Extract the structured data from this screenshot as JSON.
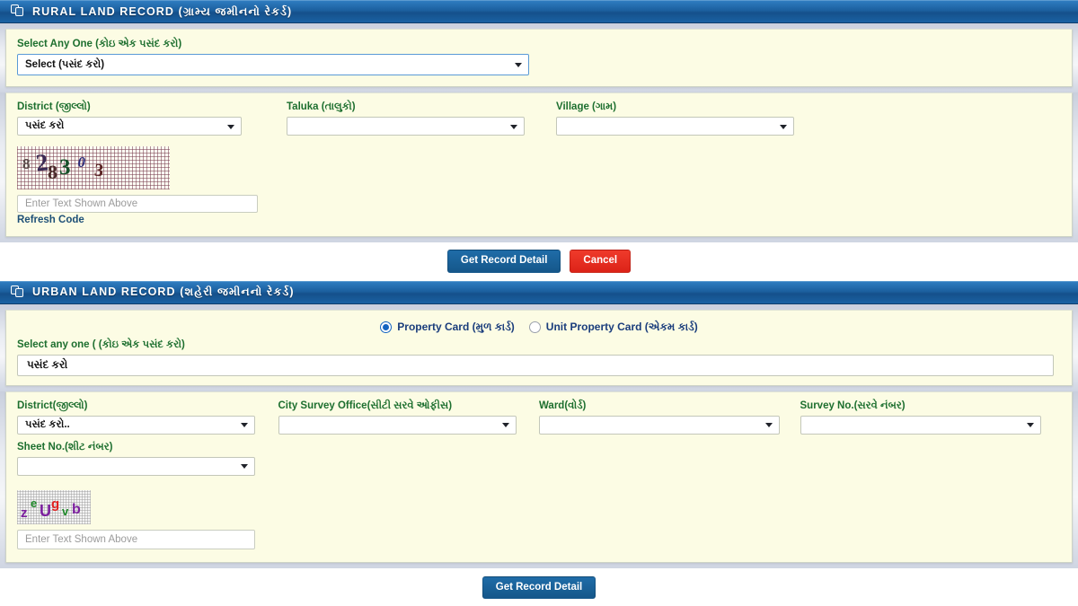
{
  "rural": {
    "header": {
      "icon": "copy-pages-icon",
      "title": "RURAL LAND RECORD (ગ્રામ્ય જમીનનો રેકર્ડ)"
    },
    "select_any_one": {
      "label": "Select Any One (કોઇ એક પસંદ કરો)",
      "value": "Select (પસંદ કરો)"
    },
    "district": {
      "label": "District (જીલ્લો)",
      "value": "પસંદ કરો"
    },
    "taluka": {
      "label": "Taluka (તાલુકો)",
      "value": ""
    },
    "village": {
      "label": "Village (ગામ)",
      "value": ""
    },
    "captcha": {
      "chars": [
        "8",
        "2",
        "8",
        "3",
        "0",
        "3"
      ],
      "input_placeholder": "Enter Text Shown Above",
      "input_value": "",
      "refresh_label": "Refresh Code"
    },
    "buttons": {
      "submit": "Get Record Detail",
      "cancel": "Cancel"
    }
  },
  "urban": {
    "header": {
      "icon": "copy-pages-icon",
      "title": "URBAN LAND RECORD (શહેરી જમીનનો રેકર્ડ)"
    },
    "card_type": {
      "options": [
        {
          "label": "Property Card (મુળ કાર્ડ)",
          "selected": true
        },
        {
          "label": "Unit Property Card (એકમ કાર્ડ)",
          "selected": false
        }
      ]
    },
    "select_any_one": {
      "label": "Select any one ( (કોઇ એક પસંદ કરો)",
      "value": "પસંદ કરો"
    },
    "district": {
      "label": "District(જીલ્લો)",
      "value": "પસંદ કરો.."
    },
    "city_survey_office": {
      "label": "City Survey Office(સીટી સરવે ઓફીસ)",
      "value": ""
    },
    "ward": {
      "label": "Ward(વોર્ડ)",
      "value": ""
    },
    "survey_no": {
      "label": "Survey No.(સરવે નંબર)",
      "value": ""
    },
    "sheet_no": {
      "label": "Sheet No.(શીટ નંબર)",
      "value": ""
    },
    "captcha": {
      "chars": [
        {
          "ch": "z",
          "color": "#7b1f9e"
        },
        {
          "ch": "e",
          "color": "#1f8a2a"
        },
        {
          "ch": "U",
          "color": "#7b1f9e"
        },
        {
          "ch": "g",
          "color": "#e02020"
        },
        {
          "ch": "v",
          "color": "#1f8a2a"
        },
        {
          "ch": "b",
          "color": "#7b1f9e"
        }
      ],
      "input_placeholder": "Enter Text Shown Above",
      "input_value": ""
    },
    "buttons": {
      "submit": "Get Record Detail"
    }
  },
  "theme": {
    "header_blue": "#1b5f9e",
    "panel_cream": "#fcfce4",
    "label_green": "#1d6f2f",
    "primary_blue": "#1f6ca8",
    "danger_red": "#ef3b2b"
  }
}
